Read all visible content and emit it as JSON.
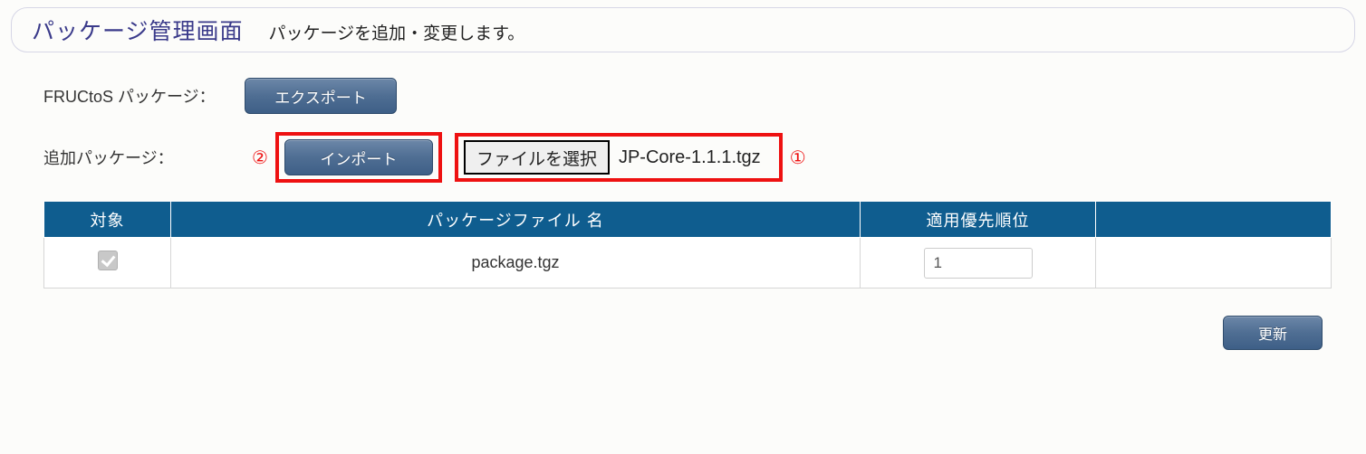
{
  "header": {
    "title": "パッケージ管理画面",
    "subtitle": "パッケージを追加・変更します。"
  },
  "labels": {
    "fructos_package": "FRUCtoS パッケージ：",
    "additional_package": "追加パッケージ："
  },
  "buttons": {
    "export": "エクスポート",
    "import": "インポート",
    "choose_file": "ファイルを選択",
    "update": "更新"
  },
  "annotations": {
    "step1": "①",
    "step2": "②"
  },
  "file": {
    "selected_name": "JP-Core-1.1.1.tgz"
  },
  "table": {
    "headers": {
      "target": "対象",
      "filename": "パッケージファイル 名",
      "priority": "適用優先順位",
      "action": ""
    },
    "rows": [
      {
        "checked": true,
        "filename": "package.tgz",
        "priority": "1"
      }
    ]
  }
}
